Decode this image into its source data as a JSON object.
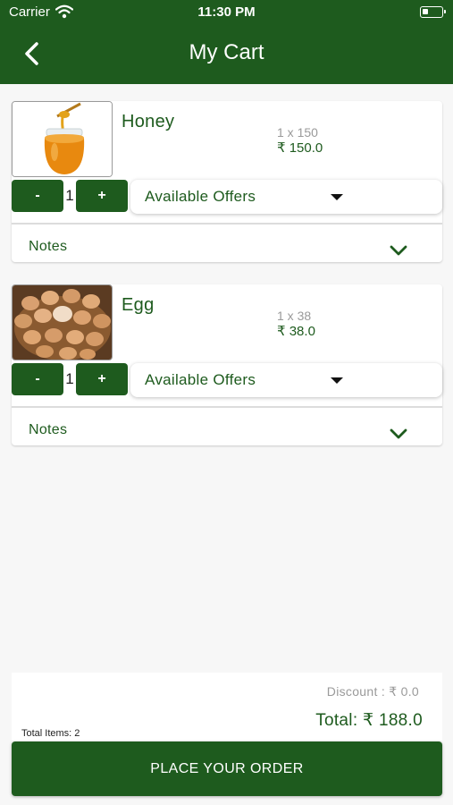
{
  "status_bar": {
    "carrier": "Carrier",
    "time": "11:30 PM"
  },
  "header": {
    "title": "My Cart"
  },
  "cart": {
    "items": [
      {
        "name": "Honey",
        "qty_line": "1 x 150",
        "price": "₹ 150.0",
        "qty": "1",
        "offers_label": "Available Offers",
        "notes_label": "Notes",
        "image_icon": "honey-jar-icon"
      },
      {
        "name": "Egg",
        "qty_line": "1 x 38",
        "price": "₹ 38.0",
        "qty": "1",
        "offers_label": "Available Offers",
        "notes_label": "Notes",
        "image_icon": "egg-basket-icon"
      }
    ],
    "minus_label": "-",
    "plus_label": "+"
  },
  "summary": {
    "total_items": "Total Items: 2",
    "discount": "Discount : ₹ 0.0",
    "total": "Total: ₹ 188.0"
  },
  "order_button": {
    "label": "PLACE YOUR ORDER"
  },
  "colors": {
    "primary": "#1e5b1e",
    "muted": "#9a9a9a",
    "background": "#f7f7f7"
  }
}
